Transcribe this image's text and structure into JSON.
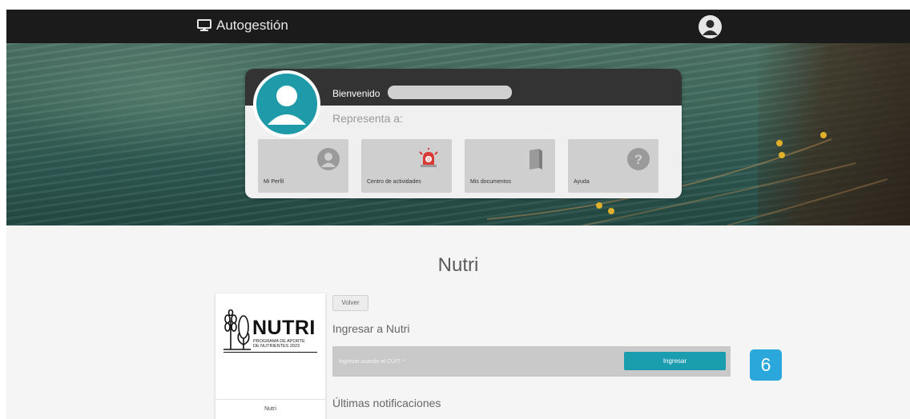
{
  "header": {
    "app_title": "Autogestión",
    "icons": {
      "brand": "monitor-icon",
      "user": "user-icon"
    }
  },
  "welcome": {
    "greeting": "Bienvenido",
    "represents_label": "Representa a:",
    "tiles": [
      {
        "label": "Mi Perfil",
        "icon": "profile-icon"
      },
      {
        "label": "Centro de actividades",
        "icon": "alarm-icon"
      },
      {
        "label": "Mis documentos",
        "icon": "documents-icon"
      },
      {
        "label": "Ayuda",
        "icon": "help-icon"
      }
    ],
    "notification_count": "0"
  },
  "main": {
    "page_title": "Nutri",
    "logo_card": {
      "brand_word": "NUTRI",
      "subtitle_line1": "PROGRAMA DE APORTE",
      "subtitle_line2": "DE NUTRIENTES 2023",
      "caption": "Nutri"
    },
    "back_button": "Volver",
    "login_title": "Ingresar a Nutri",
    "cuit_label": "Ingresar usando el CUIT: *",
    "submit_button": "Ingresar",
    "notifications_title": "Últimas notificaciones"
  },
  "step_badge": "6",
  "colors": {
    "accent": "#1b9db0",
    "avatar": "#1e9aa9",
    "badge": "#2aa8db",
    "topbar": "#1b1b1b",
    "alarm": "#d93a35"
  }
}
